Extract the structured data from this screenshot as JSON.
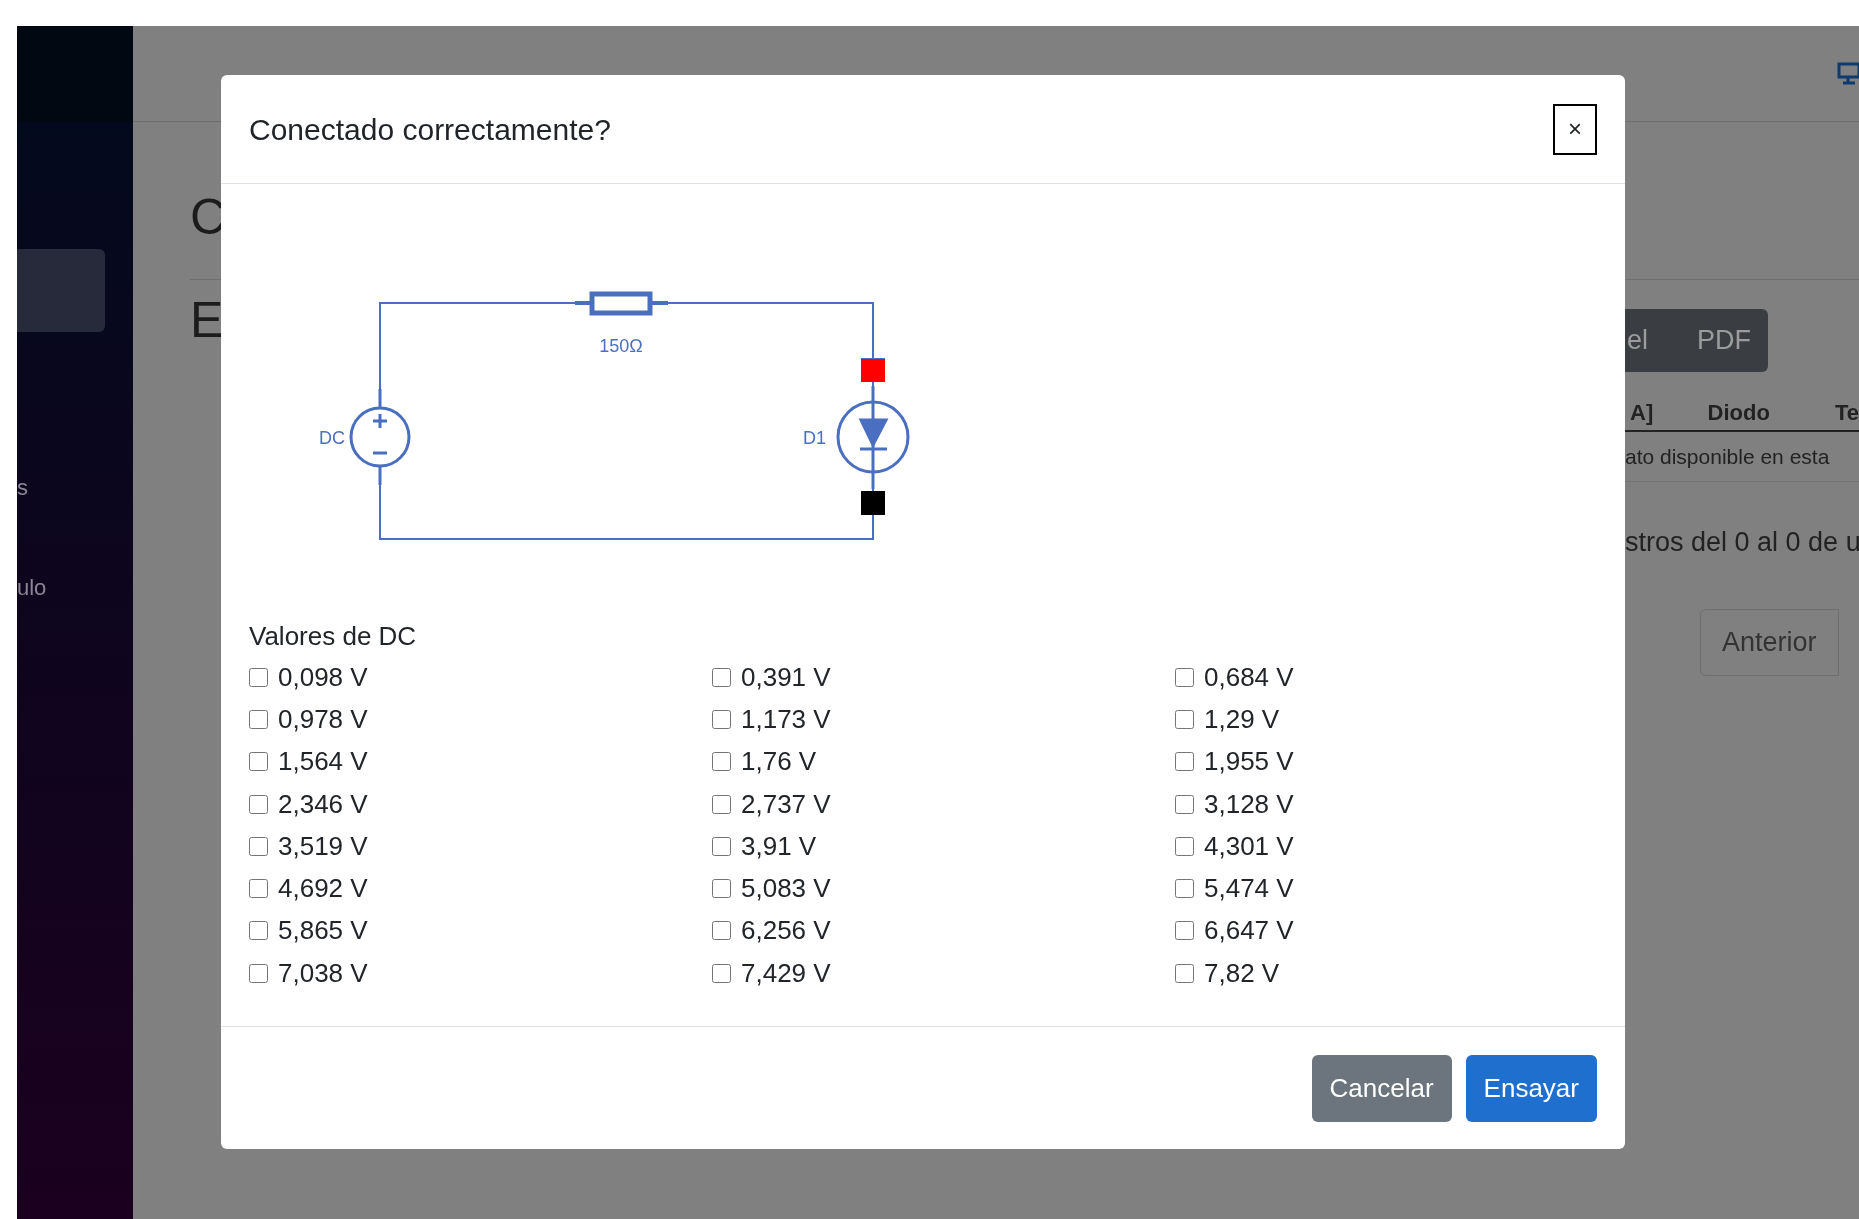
{
  "sidebar": {
    "items": [
      {
        "selected": true
      },
      {
        "label": "s",
        "selected": false
      },
      {
        "label": "ulo",
        "selected": false
      }
    ]
  },
  "page": {
    "heading": "C",
    "subheading": "E",
    "export_buttons": [
      "el",
      "PDF"
    ],
    "table": {
      "columns": [
        "A]",
        "Diodo",
        "Te"
      ],
      "empty_message": "ato disponible en esta"
    },
    "info": "stros del 0 al 0 de u",
    "pagination": [
      "Anterior"
    ]
  },
  "modal": {
    "title": "Conectado correctamente?",
    "close": "×",
    "circuit": {
      "resistor": "150Ω",
      "source": "DC",
      "diode": "D1"
    },
    "values_label": "Valores de DC",
    "values": [
      {
        "label": "0,098 V",
        "checked": false
      },
      {
        "label": "0,391 V",
        "checked": false
      },
      {
        "label": "0,684 V",
        "checked": false
      },
      {
        "label": "0,978 V",
        "checked": false
      },
      {
        "label": "1,173 V",
        "checked": false
      },
      {
        "label": "1,29 V",
        "checked": false
      },
      {
        "label": "1,564 V",
        "checked": false
      },
      {
        "label": "1,76 V",
        "checked": false
      },
      {
        "label": "1,955 V",
        "checked": false
      },
      {
        "label": "2,346 V",
        "checked": false
      },
      {
        "label": "2,737 V",
        "checked": false
      },
      {
        "label": "3,128 V",
        "checked": false
      },
      {
        "label": "3,519 V",
        "checked": false
      },
      {
        "label": "3,91 V",
        "checked": false
      },
      {
        "label": "4,301 V",
        "checked": false
      },
      {
        "label": "4,692 V",
        "checked": false
      },
      {
        "label": "5,083 V",
        "checked": false
      },
      {
        "label": "5,474 V",
        "checked": false
      },
      {
        "label": "5,865 V",
        "checked": false
      },
      {
        "label": "6,256 V",
        "checked": false
      },
      {
        "label": "6,647 V",
        "checked": false
      },
      {
        "label": "7,038 V",
        "checked": false
      },
      {
        "label": "7,429 V",
        "checked": false
      },
      {
        "label": "7,82 V",
        "checked": false
      }
    ],
    "buttons": [
      {
        "label": "Cancelar",
        "kind": "secondary"
      },
      {
        "label": "Ensayar",
        "kind": "primary"
      }
    ]
  }
}
